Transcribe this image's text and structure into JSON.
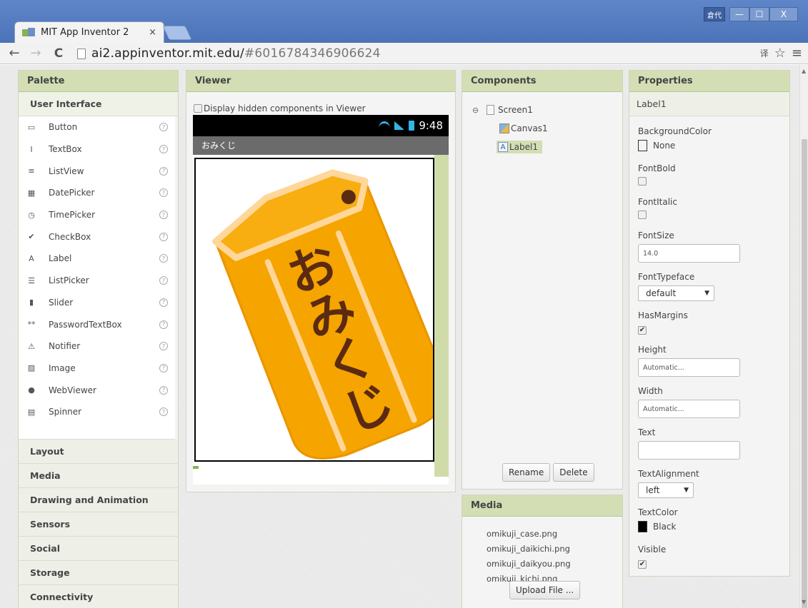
{
  "browser": {
    "tab_title": "MIT App Inventor 2",
    "tab_close": "×",
    "ime_label": "倉代",
    "url_host": "ai2.appinventor.mit.edu/",
    "url_fragment": "#6016784346906624",
    "back": "←",
    "forward": "→",
    "reload": "C",
    "star": "☆",
    "menu": "≡",
    "translate": "译",
    "minimize": "—",
    "maximize": "☐",
    "close": "X"
  },
  "palette": {
    "header": "Palette",
    "open_category": "User Interface",
    "items": [
      {
        "label": "Button",
        "icon": "button-icon"
      },
      {
        "label": "TextBox",
        "icon": "textbox-icon"
      },
      {
        "label": "ListView",
        "icon": "listview-icon"
      },
      {
        "label": "DatePicker",
        "icon": "datepicker-icon"
      },
      {
        "label": "TimePicker",
        "icon": "timepicker-icon"
      },
      {
        "label": "CheckBox",
        "icon": "checkbox-icon"
      },
      {
        "label": "Label",
        "icon": "label-icon"
      },
      {
        "label": "ListPicker",
        "icon": "listpicker-icon"
      },
      {
        "label": "Slider",
        "icon": "slider-icon"
      },
      {
        "label": "PasswordTextBox",
        "icon": "passwordtextbox-icon"
      },
      {
        "label": "Notifier",
        "icon": "notifier-icon"
      },
      {
        "label": "Image",
        "icon": "image-icon"
      },
      {
        "label": "WebViewer",
        "icon": "webviewer-icon"
      },
      {
        "label": "Spinner",
        "icon": "spinner-icon"
      }
    ],
    "help": "?",
    "categories": [
      "Layout",
      "Media",
      "Drawing and Animation",
      "Sensors",
      "Social",
      "Storage",
      "Connectivity"
    ]
  },
  "viewer": {
    "header": "Viewer",
    "display_hidden": "Display hidden components in Viewer",
    "status_time": "9:48",
    "app_title": "おみくじ",
    "image_text": "おみくじ"
  },
  "components": {
    "header": "Components",
    "screen": "Screen1",
    "canvas": "Canvas1",
    "label": "Label1",
    "toggle": "⊖",
    "rename": "Rename",
    "delete": "Delete"
  },
  "media": {
    "header": "Media",
    "files": [
      "omikuji_case.png",
      "omikuji_daikichi.png",
      "omikuji_daikyou.png",
      "omikuji_kichi.png"
    ],
    "upload": "Upload File ..."
  },
  "properties": {
    "header": "Properties",
    "component": "Label1",
    "background_color_label": "BackgroundColor",
    "background_color": "None",
    "font_bold_label": "FontBold",
    "font_italic_label": "FontItalic",
    "font_size_label": "FontSize",
    "font_size": "14.0",
    "font_typeface_label": "FontTypeface",
    "font_typeface": "default",
    "has_margins_label": "HasMargins",
    "height_label": "Height",
    "height": "Automatic...",
    "width_label": "Width",
    "width": "Automatic...",
    "text_label": "Text",
    "text": "",
    "text_alignment_label": "TextAlignment",
    "text_alignment": "left",
    "text_color_label": "TextColor",
    "text_color": "Black",
    "visible_label": "Visible",
    "check": "✔",
    "dropdown_arrow": "▼"
  },
  "colors": {
    "header_green": "#d3deb4",
    "chrome_blue": "#4b73b7",
    "omikuji_orange": "#f7a800",
    "omikuji_text": "#5a2a12"
  }
}
